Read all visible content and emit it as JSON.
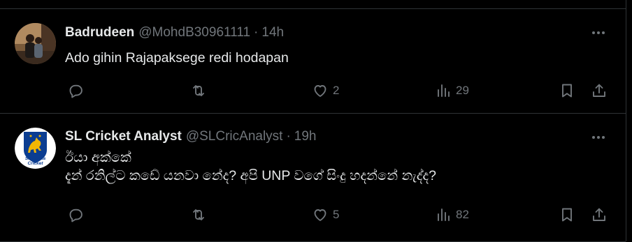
{
  "tweets": [
    {
      "name": "Badrudeen",
      "handle": "@MohdB30961111",
      "separator": "·",
      "time": "14h",
      "text": [
        "Ado gihin Rajapaksege redi hodapan"
      ],
      "replies": "",
      "retweets": "",
      "likes": "2",
      "views": "29",
      "avatar": "photo-avatar"
    },
    {
      "name": "SL Cricket Analyst",
      "handle": "@SLCricAnalyst",
      "separator": "·",
      "time": "19h",
      "text": [
        "ඊයා අක්කේ",
        "දැන් රනිල්ට කඩේ යනවා නේද? අපි UNP වගේ සිංදු හදන්නේ නැද්ද?"
      ],
      "replies": "",
      "retweets": "",
      "likes": "5",
      "views": "82",
      "avatar": "sri-lanka-cricket-logo",
      "avatar_text": [
        "Sri Lanka",
        "Cricket"
      ]
    }
  ],
  "colors": {
    "background": "#000000",
    "text_primary": "#e7e9ea",
    "text_secondary": "#71767b",
    "divider": "#2f3336",
    "logo_blue": "#0b3d91",
    "logo_gold": "#f2b705"
  }
}
